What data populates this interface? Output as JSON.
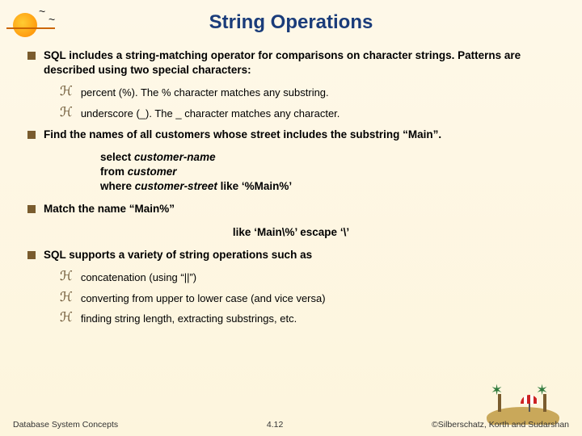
{
  "title": "String Operations",
  "bullets": {
    "b1": "SQL includes a string-matching operator for comparisons on character strings.  Patterns are described using two special characters:",
    "b1_s1": "percent (%).  The % character matches any substring.",
    "b1_s2": "underscore (_).  The _ character matches any character.",
    "b2": "Find the names of all customers whose street includes the substring “Main”.",
    "b3": "Match the name “Main%”",
    "b4": "SQL supports a variety of string operations such as",
    "b4_s1": "concatenation (using “||”)",
    "b4_s2": "converting from upper to lower case (and vice versa)",
    "b4_s3": "finding string length, extracting substrings, etc."
  },
  "code": {
    "select_kw": "select",
    "select_id": "customer-name",
    "from_kw": "from",
    "from_id": "customer",
    "where_kw": "where",
    "where_id": "customer-street",
    "like_kw": "like",
    "like_lit": "‘%Main%’"
  },
  "center": {
    "like_kw": "like",
    "like_lit": "‘Main\\%’",
    "escape_kw": "escape",
    "escape_lit": "‘\\’"
  },
  "footer": {
    "left": "Database System Concepts",
    "center": "4.12",
    "right": "©Silberschatz, Korth and Sudarshan"
  }
}
